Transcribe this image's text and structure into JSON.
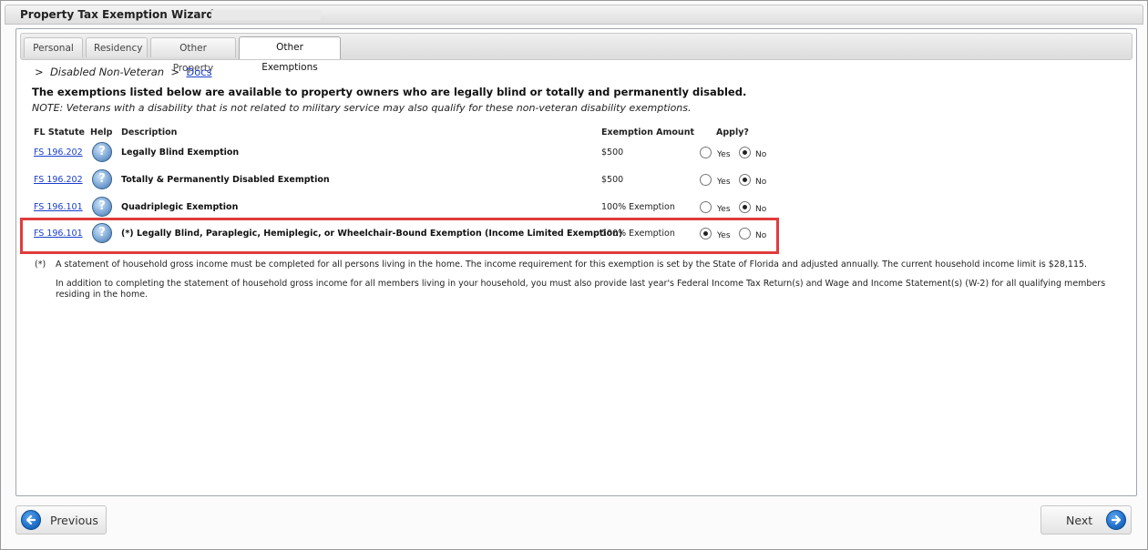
{
  "window": {
    "title": "Property Tax Exemption Wizard -"
  },
  "tabs": [
    {
      "label": "Personal",
      "active": false
    },
    {
      "label": "Residency",
      "active": false
    },
    {
      "label": "Other Property",
      "active": false
    },
    {
      "label": "Other Exemptions",
      "active": true
    }
  ],
  "breadcrumb": {
    "sep1": ">",
    "crumb": "Disabled Non-Veteran",
    "sep2": ">",
    "link": "Docs"
  },
  "intro": {
    "heading": "The exemptions listed below are available to property owners who are legally blind or totally and permanently disabled.",
    "note": "NOTE: Veterans with a disability that is not related to military service may also qualify for these non-veteran disability exemptions."
  },
  "table": {
    "headers": {
      "statute": "FL Statute",
      "help": "Help",
      "description": "Description",
      "amount": "Exemption Amount",
      "apply": "Apply?"
    },
    "yes_label": "Yes",
    "no_label": "No",
    "help_glyph": "?",
    "rows": [
      {
        "statute": "FS 196.202",
        "description": "Legally Blind Exemption",
        "amount": "$500",
        "apply": "No"
      },
      {
        "statute": "FS 196.202",
        "description": "Totally & Permanently Disabled Exemption",
        "amount": "$500",
        "apply": "No"
      },
      {
        "statute": "FS 196.101",
        "description": "Quadriplegic Exemption",
        "amount": "100% Exemption",
        "apply": "No"
      },
      {
        "statute": "FS 196.101",
        "description": "(*) Legally Blind, Paraplegic, Hemiplegic, or Wheelchair-Bound Exemption (Income Limited Exemption)",
        "amount": "100% Exemption",
        "apply": "Yes"
      }
    ]
  },
  "footnote": {
    "mark": "(*)",
    "line1": "A statement of household gross income must be completed for all persons living in the home. The income requirement for this exemption is set by the State of Florida and adjusted annually. The current household income limit is $28,115.",
    "line2": "In addition to completing the statement of household gross income for all members living in your household, you must also provide last year's Federal Income Tax Return(s) and Wage and Income Statement(s) (W-2) for all qualifying members residing in the home."
  },
  "buttons": {
    "previous": "Previous",
    "next": "Next"
  },
  "colors": {
    "highlight": "#e03c3c",
    "link": "#1a3fcc",
    "nav_button": "#1f6fc9"
  },
  "icons": {
    "help": "help-question-icon",
    "previous": "arrow-left-circle-icon",
    "next": "arrow-right-circle-icon"
  }
}
